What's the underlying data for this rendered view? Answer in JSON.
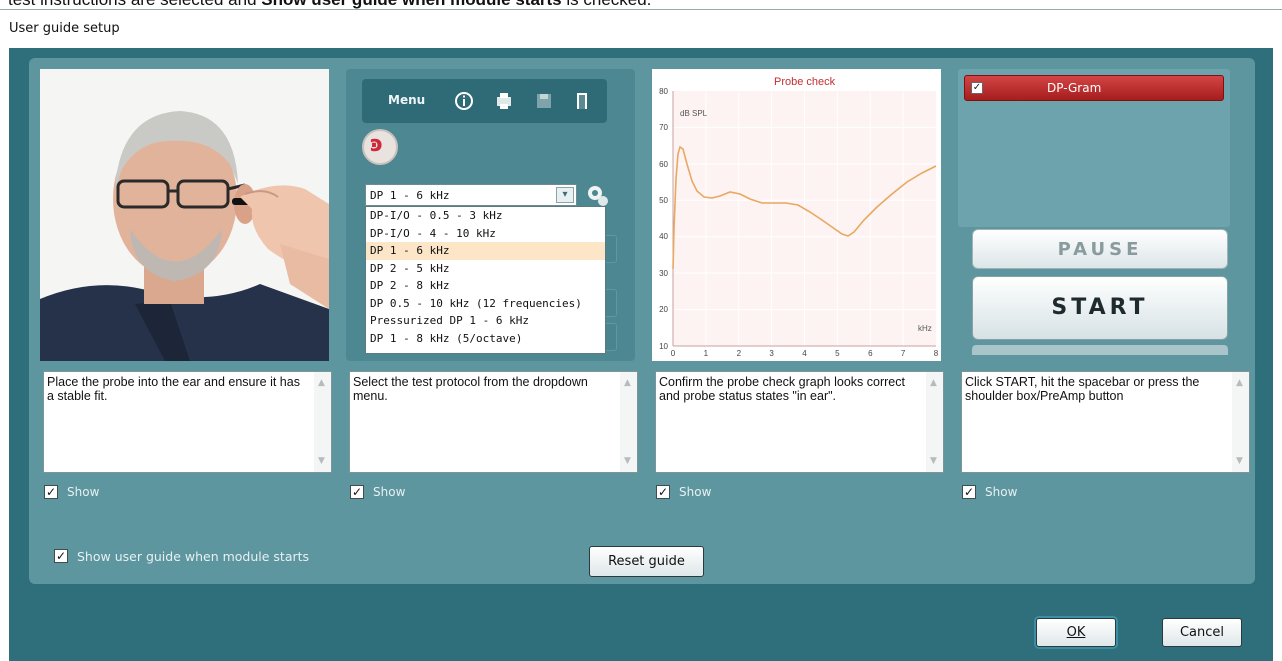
{
  "caption": {
    "pre": "test instructions are selected and ",
    "bold": "Show user guide when module starts",
    "post": " is checked."
  },
  "window": {
    "title": "User guide setup"
  },
  "steps": [
    {
      "text": "Place the probe into the ear and ensure it has a stable fit.",
      "show_label": "Show",
      "checked": true
    },
    {
      "text": "Select the test protocol from the dropdown menu.",
      "show_label": "Show",
      "checked": true
    },
    {
      "text": "Confirm the probe check graph looks correct and probe status states \"in ear\".",
      "show_label": "Show",
      "checked": true
    },
    {
      "text": "Click START, hit the spacebar or press the shoulder box/PreAmp button",
      "show_label": "Show",
      "checked": true
    }
  ],
  "menu_panel": {
    "menu_label": "Menu",
    "selected_protocol": "DP 1 - 6 kHz",
    "protocols": [
      "DP-I/O - 0.5 - 3 kHz",
      "DP-I/O - 4 - 10 kHz",
      "DP 1 - 6 kHz",
      "DP 2 - 5 kHz",
      "DP 2 - 8 kHz",
      "DP 0.5 - 10 kHz (12 frequencies)",
      "Pressurized DP 1 - 6 kHz",
      "DP 1 - 8 kHz (5/octave)"
    ]
  },
  "probe_graph": {
    "title": "Probe check",
    "y_unit": "dB SPL",
    "x_unit": "kHz",
    "y_ticks": [
      "80",
      "70",
      "60",
      "50",
      "40",
      "30",
      "20",
      "10"
    ],
    "x_ticks": [
      "0",
      "1",
      "2",
      "3",
      "4",
      "5",
      "6",
      "7",
      "8"
    ]
  },
  "start_panel": {
    "dp_gram_label": "DP-Gram",
    "pause_label": "PAUSE",
    "start_label": "START"
  },
  "footer": {
    "show_guide_label": "Show user guide when module starts",
    "show_guide_checked": true,
    "reset_label": "Reset guide",
    "ok_label": "OK",
    "cancel_label": "Cancel"
  },
  "colors": {
    "frame": "#2f6f7c",
    "panel": "#5e96a0",
    "dp_gram": "#c03030",
    "curve": "#e8a860"
  }
}
